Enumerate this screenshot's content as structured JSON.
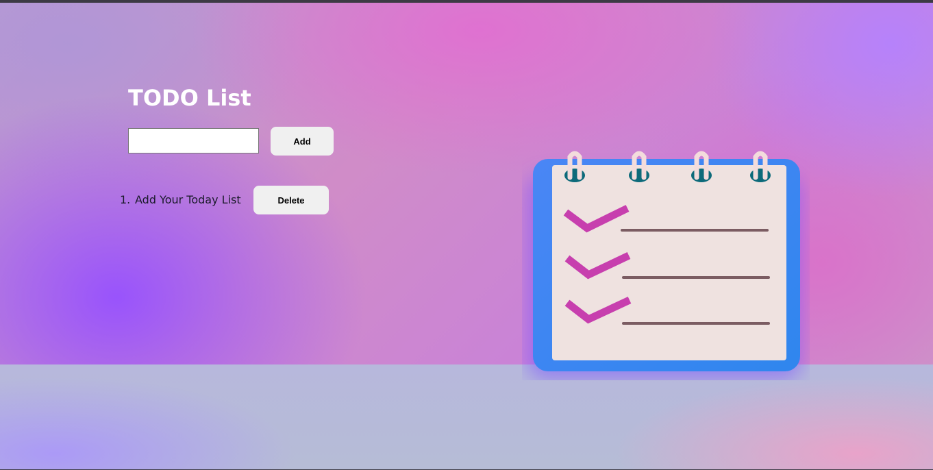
{
  "header": {
    "title": "TODO List"
  },
  "form": {
    "input_value": "",
    "input_placeholder": "",
    "add_label": "Add"
  },
  "tasks": [
    {
      "index": "1.",
      "text": "Add Your Today List",
      "delete_label": "Delete"
    }
  ],
  "illustration": {
    "icon": "checklist-notepad-icon"
  },
  "colors": {
    "title": "#ffffff",
    "button_bg": "#f0f0f0",
    "notepad_frame": "#3b8cf0",
    "notepad_paper": "#efe2e0",
    "checkmark": "#c73fae"
  }
}
